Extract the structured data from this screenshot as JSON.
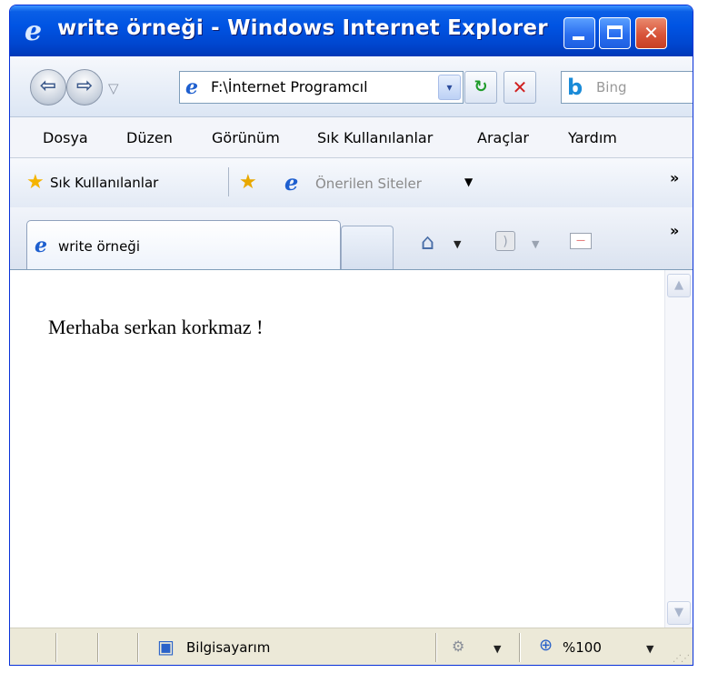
{
  "window": {
    "title": "write örneği - Windows Internet Explorer",
    "minimize_glyph": "",
    "maximize_glyph": "",
    "close_glyph": "✕"
  },
  "nav": {
    "back_glyph": "⇦",
    "forward_glyph": "⇨",
    "history_glyph": "▽",
    "address": "F:\\İnternet Programcıl",
    "address_dropdown_glyph": "▾",
    "refresh_glyph": "↻",
    "stop_glyph": "✕",
    "search_placeholder": "Bing"
  },
  "menu": {
    "items": [
      "Dosya",
      "Düzen",
      "Görünüm",
      "Sık Kullanılanlar",
      "Araçlar",
      "Yardım"
    ]
  },
  "favorites": {
    "label": "Sık Kullanılanlar",
    "suggested_sites": "Önerilen Siteler",
    "more_glyph": "»"
  },
  "tabs": {
    "active_tab": "write örneği",
    "more_glyph": "»"
  },
  "page": {
    "text": "Merhaba serkan korkmaz !"
  },
  "status": {
    "zone": "Bilgisayarım",
    "zoom": "%100"
  },
  "colors": {
    "titlebar": "#0054e3",
    "close_button": "#d8543a",
    "chrome": "#ece9d8"
  },
  "icons": {
    "title": "ie-logo-icon",
    "address": "ie-page-icon",
    "search_provider": "bing-icon",
    "favorites": "star-icon",
    "add_favorite": "add-favorite-icon",
    "home": "home-icon",
    "feeds": "rss-icon",
    "mail": "mail-icon",
    "status_zone": "computer-icon",
    "zoom": "magnifier-icon"
  }
}
